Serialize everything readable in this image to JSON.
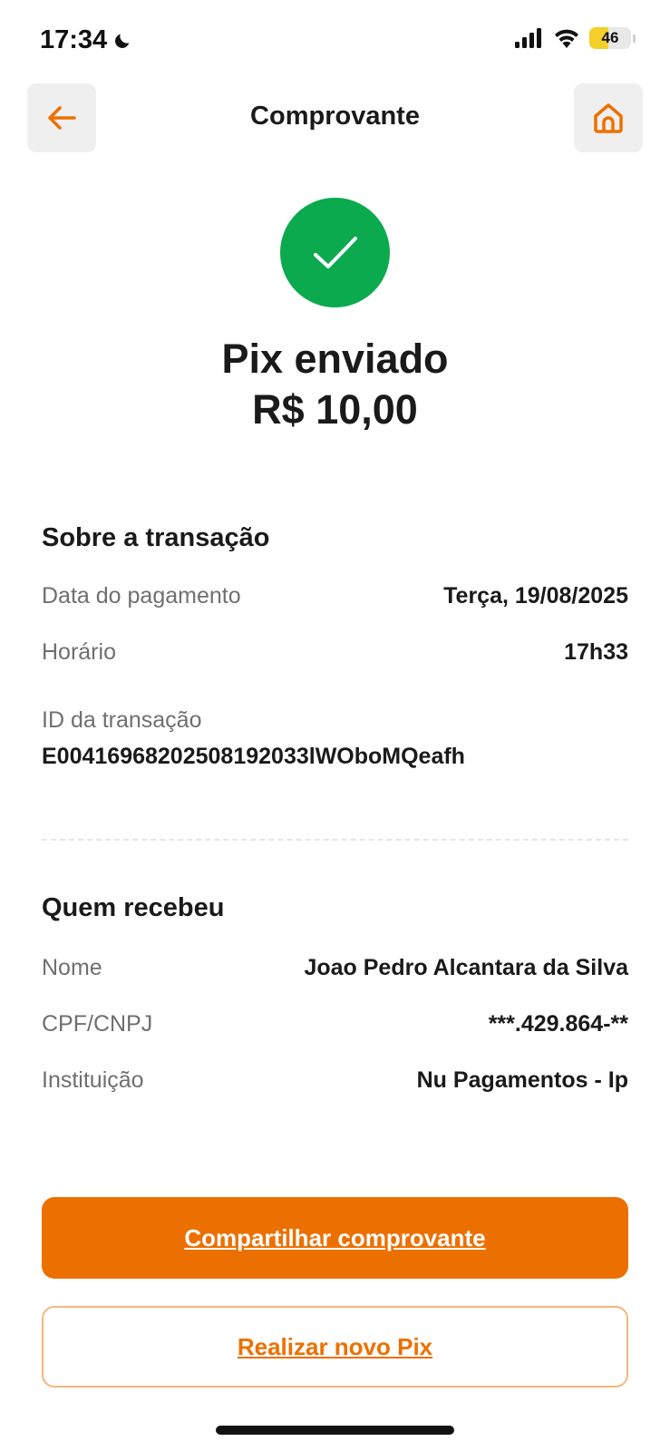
{
  "status_bar": {
    "time": "17:34",
    "battery": "46",
    "battery_level": 0.46,
    "battery_color": "#f5cf2a"
  },
  "header": {
    "title": "Comprovante",
    "back_icon": "arrow-left-icon",
    "home_icon": "home-icon"
  },
  "success": {
    "icon": "checkmark-icon",
    "title": "Pix enviado",
    "amount": "R$ 10,00"
  },
  "transaction": {
    "title": "Sobre a transação",
    "date_label": "Data do pagamento",
    "date_value": "Terça, 19/08/2025",
    "time_label": "Horário",
    "time_value": "17h33",
    "id_label": "ID da transação",
    "id_value": "E00416968202508192033lWOboMQeafh"
  },
  "recipient": {
    "title": "Quem recebeu",
    "name_label": "Nome",
    "name_value": "Joao Pedro Alcantara da Silva",
    "doc_label": "CPF/CNPJ",
    "doc_value": "***.429.864-**",
    "institution_label": "Instituição",
    "institution_value": "Nu Pagamentos - Ip"
  },
  "actions": {
    "share_label": "Compartilhar comprovante",
    "new_pix_label": "Realizar novo Pix"
  },
  "colors": {
    "accent": "#ec7000",
    "success": "#0baa4f"
  }
}
